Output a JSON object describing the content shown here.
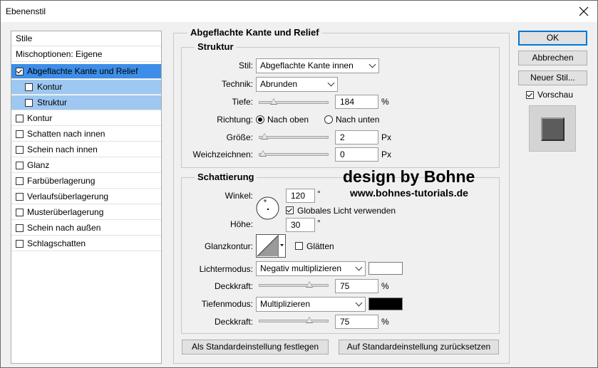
{
  "window": {
    "title": "Ebenenstil"
  },
  "styles_panel": {
    "header": "Stile",
    "blend_options": "Mischoptionen: Eigene",
    "items": [
      {
        "label": "Abgeflachte Kante und Relief",
        "checked": true
      },
      {
        "label": "Kontur",
        "checked": false
      },
      {
        "label": "Struktur",
        "checked": false
      },
      {
        "label": "Kontur",
        "checked": false
      },
      {
        "label": "Schatten nach innen",
        "checked": false
      },
      {
        "label": "Schein nach innen",
        "checked": false
      },
      {
        "label": "Glanz",
        "checked": false
      },
      {
        "label": "Farbüberlagerung",
        "checked": false
      },
      {
        "label": "Verlaufsüberlagerung",
        "checked": false
      },
      {
        "label": "Musterüberlagerung",
        "checked": false
      },
      {
        "label": "Schein nach außen",
        "checked": false
      },
      {
        "label": "Schlagschatten",
        "checked": false
      }
    ]
  },
  "main": {
    "section_title": "Abgeflachte Kante und Relief",
    "struktur": {
      "title": "Struktur",
      "stil_label": "Stil:",
      "stil_value": "Abgeflachte Kante innen",
      "technik_label": "Technik:",
      "technik_value": "Abrunden",
      "tiefe_label": "Tiefe:",
      "tiefe_value": "184",
      "tiefe_unit": "%",
      "tiefe_level": 0.18,
      "richtung_label": "Richtung:",
      "richtung_up": "Nach oben",
      "richtung_down": "Nach unten",
      "groesse_label": "Größe:",
      "groesse_value": "2",
      "groesse_unit": "Px",
      "groesse_level": 0.02,
      "weich_label": "Weichzeichnen:",
      "weich_value": "0",
      "weich_unit": "Px",
      "weich_level": 0.0
    },
    "schattierung": {
      "title": "Schattierung",
      "winkel_label": "Winkel:",
      "winkel_value": "120",
      "winkel_unit": "°",
      "global_light_label": "Globales Licht verwenden",
      "hoehe_label": "Höhe:",
      "hoehe_value": "30",
      "hoehe_unit": "°",
      "glanzkontur_label": "Glanzkontur:",
      "glaetten_label": "Glätten",
      "lichtermodus_label": "Lichtermodus:",
      "lichtermodus_value": "Negativ multiplizieren",
      "deckkraft1_label": "Deckkraft:",
      "deckkraft1_value": "75",
      "deckkraft1_unit": "%",
      "deckkraft1_level": 0.75,
      "tiefenmodus_label": "Tiefenmodus:",
      "tiefenmodus_value": "Multiplizieren",
      "deckkraft2_label": "Deckkraft:",
      "deckkraft2_value": "75",
      "deckkraft2_unit": "%",
      "deckkraft2_level": 0.75,
      "highlight_color": "#ffffff",
      "shadow_color": "#000000"
    },
    "buttons": {
      "make_default": "Als Standardeinstellung festlegen",
      "reset_default": "Auf Standardeinstellung zurücksetzen"
    }
  },
  "right": {
    "ok": "OK",
    "cancel": "Abbrechen",
    "new_style": "Neuer Stil...",
    "preview_label": "Vorschau"
  },
  "watermark": {
    "line1": "design by Bohne",
    "line2": "www.bohnes-tutorials.de"
  },
  "colors": {
    "selection": "#3d8ee8",
    "sub_selection": "#9ec8f2",
    "default_button_border": "#0078d7"
  }
}
